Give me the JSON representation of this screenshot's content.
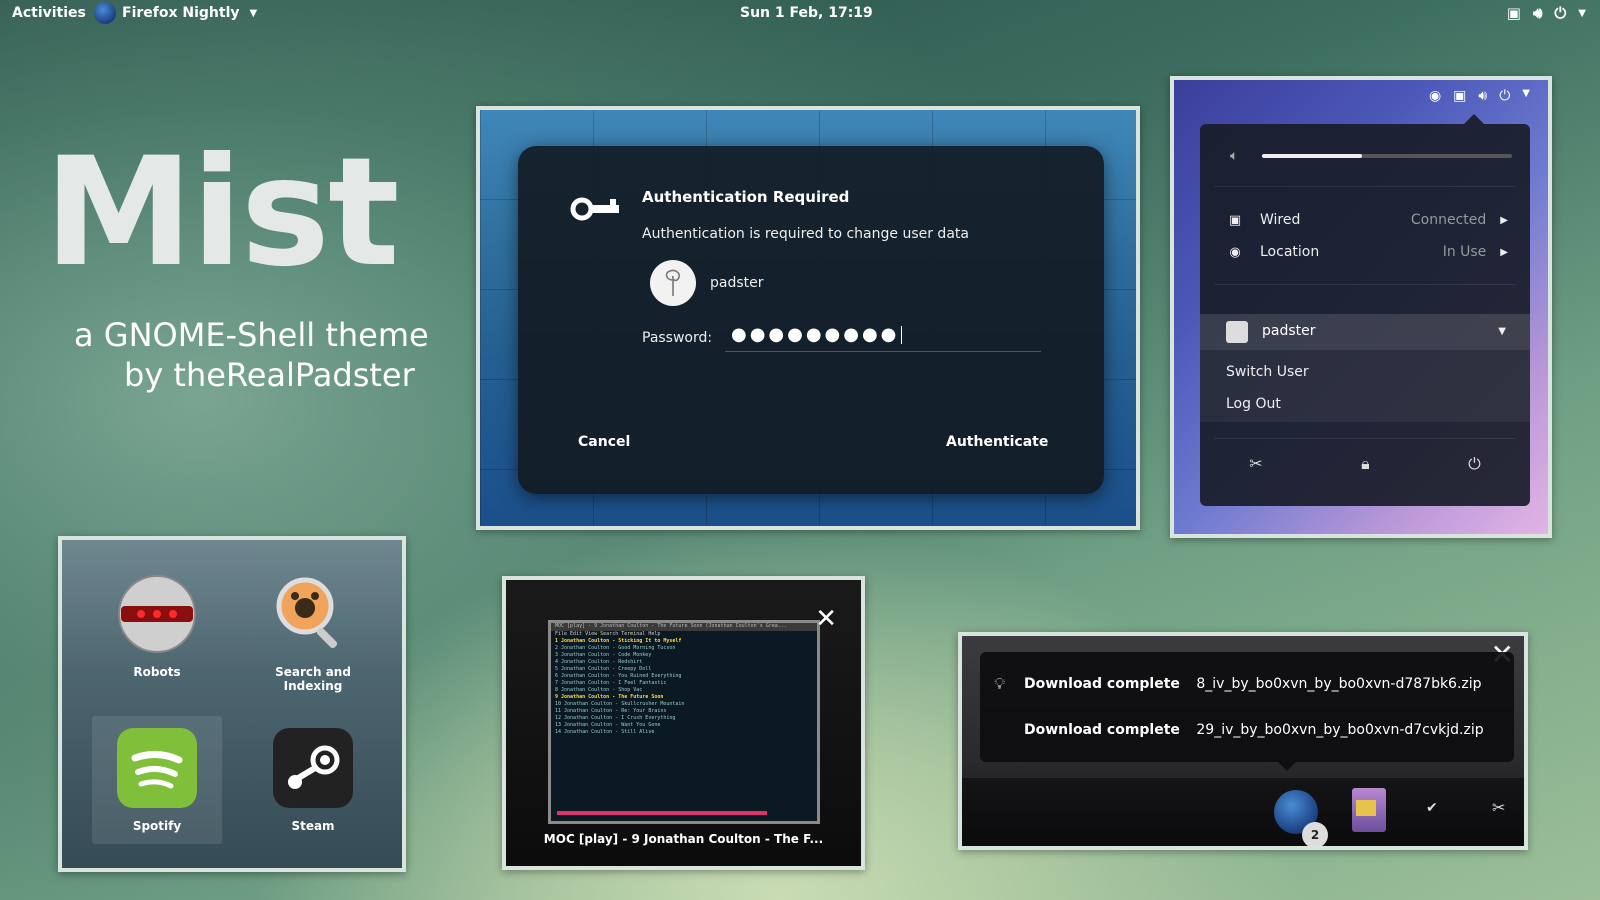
{
  "topbar": {
    "activities": "Activities",
    "app_name": "Firefox Nightly",
    "clock": "Sun  1 Feb, 17:19"
  },
  "hero": {
    "title": "Mist",
    "subtitle_line1": "a GNOME-Shell theme",
    "subtitle_line2": "by theRealPadster"
  },
  "auth_dialog": {
    "title": "Authentication Required",
    "description": "Authentication is required to change user data",
    "username": "padster",
    "password_label": "Password:",
    "password_value": "●●●●●●●●●",
    "cancel_label": "Cancel",
    "authenticate_label": "Authenticate"
  },
  "system_menu": {
    "volume_level": 0.4,
    "wired_label": "Wired",
    "wired_status": "Connected",
    "location_label": "Location",
    "location_status": "In Use",
    "user_name": "padster",
    "switch_user": "Switch User",
    "log_out": "Log Out",
    "actions": [
      "settings-icon",
      "lock-icon",
      "power-icon"
    ]
  },
  "app_grid": {
    "apps": [
      {
        "label": "Robots",
        "icon": "robots-icon"
      },
      {
        "label": "Search and Indexing",
        "icon": "search-indexing-icon"
      },
      {
        "label": "Spotify",
        "icon": "spotify-icon"
      },
      {
        "label": "Steam",
        "icon": "steam-icon"
      }
    ]
  },
  "moc_window": {
    "caption": "MOC [play] - 9 Jonathan Coulton - The F...",
    "thumb_title": "MOC [play] - 9 Jonathan Coulton - The Future Soon (Jonathan Coulton's Grea...",
    "thumb_menu": "File  Edit  View  Search  Terminal  Help"
  },
  "notifications": {
    "items": [
      {
        "title": "Download complete",
        "file": "8_iv_by_bo0xvn_by_bo0xvn-d787bk6.zip"
      },
      {
        "title": "Download complete",
        "file": "29_iv_by_bo0xvn_by_bo0xvn-d7cvkjd.zip"
      }
    ],
    "badge_count": "2"
  },
  "colors": {
    "accent_pink": "#e0306e",
    "spotify_green": "#7fbf3a"
  }
}
